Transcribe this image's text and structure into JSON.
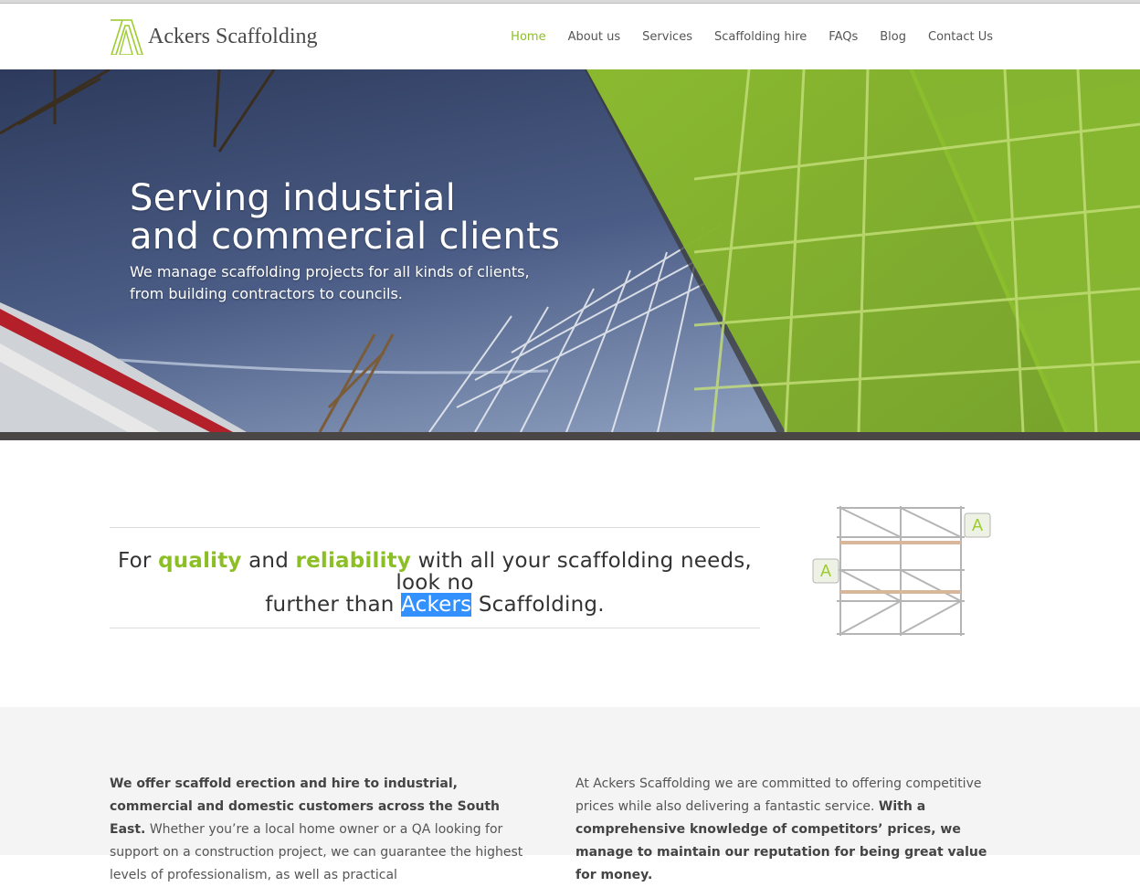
{
  "brand": {
    "name": "Ackers Scaffolding",
    "accent": "#8cbf26"
  },
  "nav": {
    "items": [
      {
        "label": "Home",
        "active": true
      },
      {
        "label": "About us"
      },
      {
        "label": "Services"
      },
      {
        "label": "Scaffolding hire"
      },
      {
        "label": "FAQs"
      },
      {
        "label": "Blog"
      },
      {
        "label": "Contact Us"
      }
    ]
  },
  "hero": {
    "title_line1": "Serving industrial",
    "title_line2": "and commercial clients",
    "sub_line1": "We manage scaffolding projects for all kinds of clients,",
    "sub_line2": "from building contractors to councils."
  },
  "intro": {
    "w1": "For",
    "w2": "quality",
    "w3": "and",
    "w4": "reliability",
    "w5": "with all your scaffolding needs, look no",
    "w6": "further than",
    "w7": "Ackers",
    "w8": "Scaffolding."
  },
  "details": {
    "left_bold": "We offer scaffold erection and hire to industrial, commercial and domestic customers across the South East.",
    "left_text": "Whether you’re a local home owner or a QA looking for support on a construction project, we can guarantee the highest levels of professionalism, as well as practical",
    "right_text": "At Ackers Scaffolding we are committed to offering competitive prices while also delivering a fantastic service.",
    "right_bold": "With a comprehensive knowledge of competitors’ prices, we manage to maintain our reputation for being great value for money."
  }
}
